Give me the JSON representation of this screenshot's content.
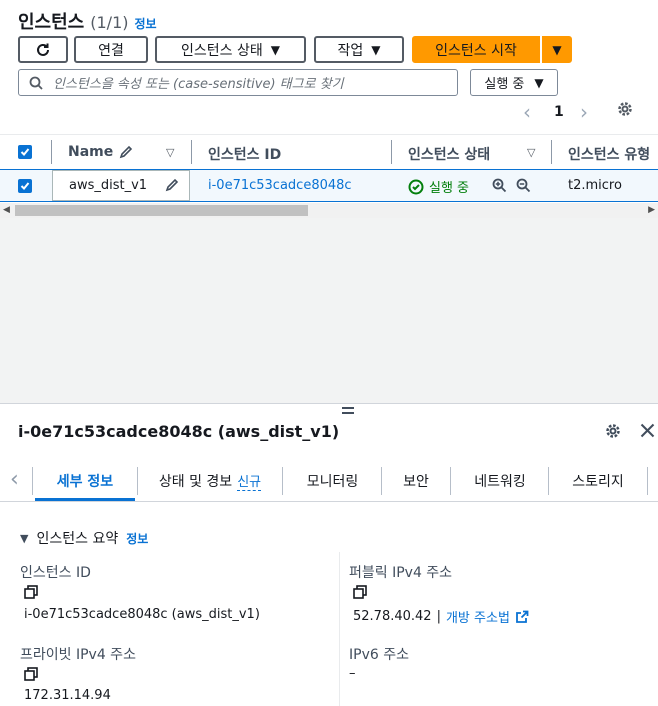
{
  "header": {
    "title": "인스턴스",
    "count": "(1/1)",
    "info_link": "정보"
  },
  "toolbar": {
    "connect": "연결",
    "instance_state": "인스턴스 상태",
    "actions": "작업",
    "launch": "인스턴스 시작"
  },
  "search": {
    "placeholder": "인스턴스을 속성 또는 (case-sensitive) 태그로 찾기",
    "state_filter": "실행 중"
  },
  "pagination": {
    "page": "1"
  },
  "table": {
    "headers": [
      "Name",
      "인스턴스 ID",
      "인스턴스 상태",
      "인스턴스 유형"
    ],
    "rows": [
      {
        "name": "aws_dist_v1",
        "id": "i-0e71c53cadce8048c",
        "state": "실행 중",
        "type": "t2.micro"
      }
    ]
  },
  "detail": {
    "title": "i-0e71c53cadce8048c (aws_dist_v1)",
    "tabs": [
      "세부 정보",
      "상태 및 경보",
      "모니터링",
      "보안",
      "네트워킹",
      "스토리지"
    ],
    "new_badge": "신규",
    "section_title": "인스턴스 요약",
    "section_info": "정보",
    "fields": {
      "instance_id_label": "인스턴스 ID",
      "instance_id_value": "i-0e71c53cadce8048c (aws_dist_v1)",
      "public_ipv4_label": "퍼블릭 IPv4 주소",
      "public_ipv4_value": "52.78.40.42",
      "public_ipv4_sep": "|",
      "open_address_link": "개방 주소법",
      "private_ipv4_label": "프라이빗 IPv4 주소",
      "private_ipv4_value": "172.31.14.94",
      "ipv6_label": "IPv6 주소",
      "ipv6_value": "–"
    }
  },
  "colors": {
    "accent": "#0972d3",
    "primary_button": "#ff9900",
    "running_green": "#037f0c",
    "selected_row_bg": "#f2f8fd"
  }
}
